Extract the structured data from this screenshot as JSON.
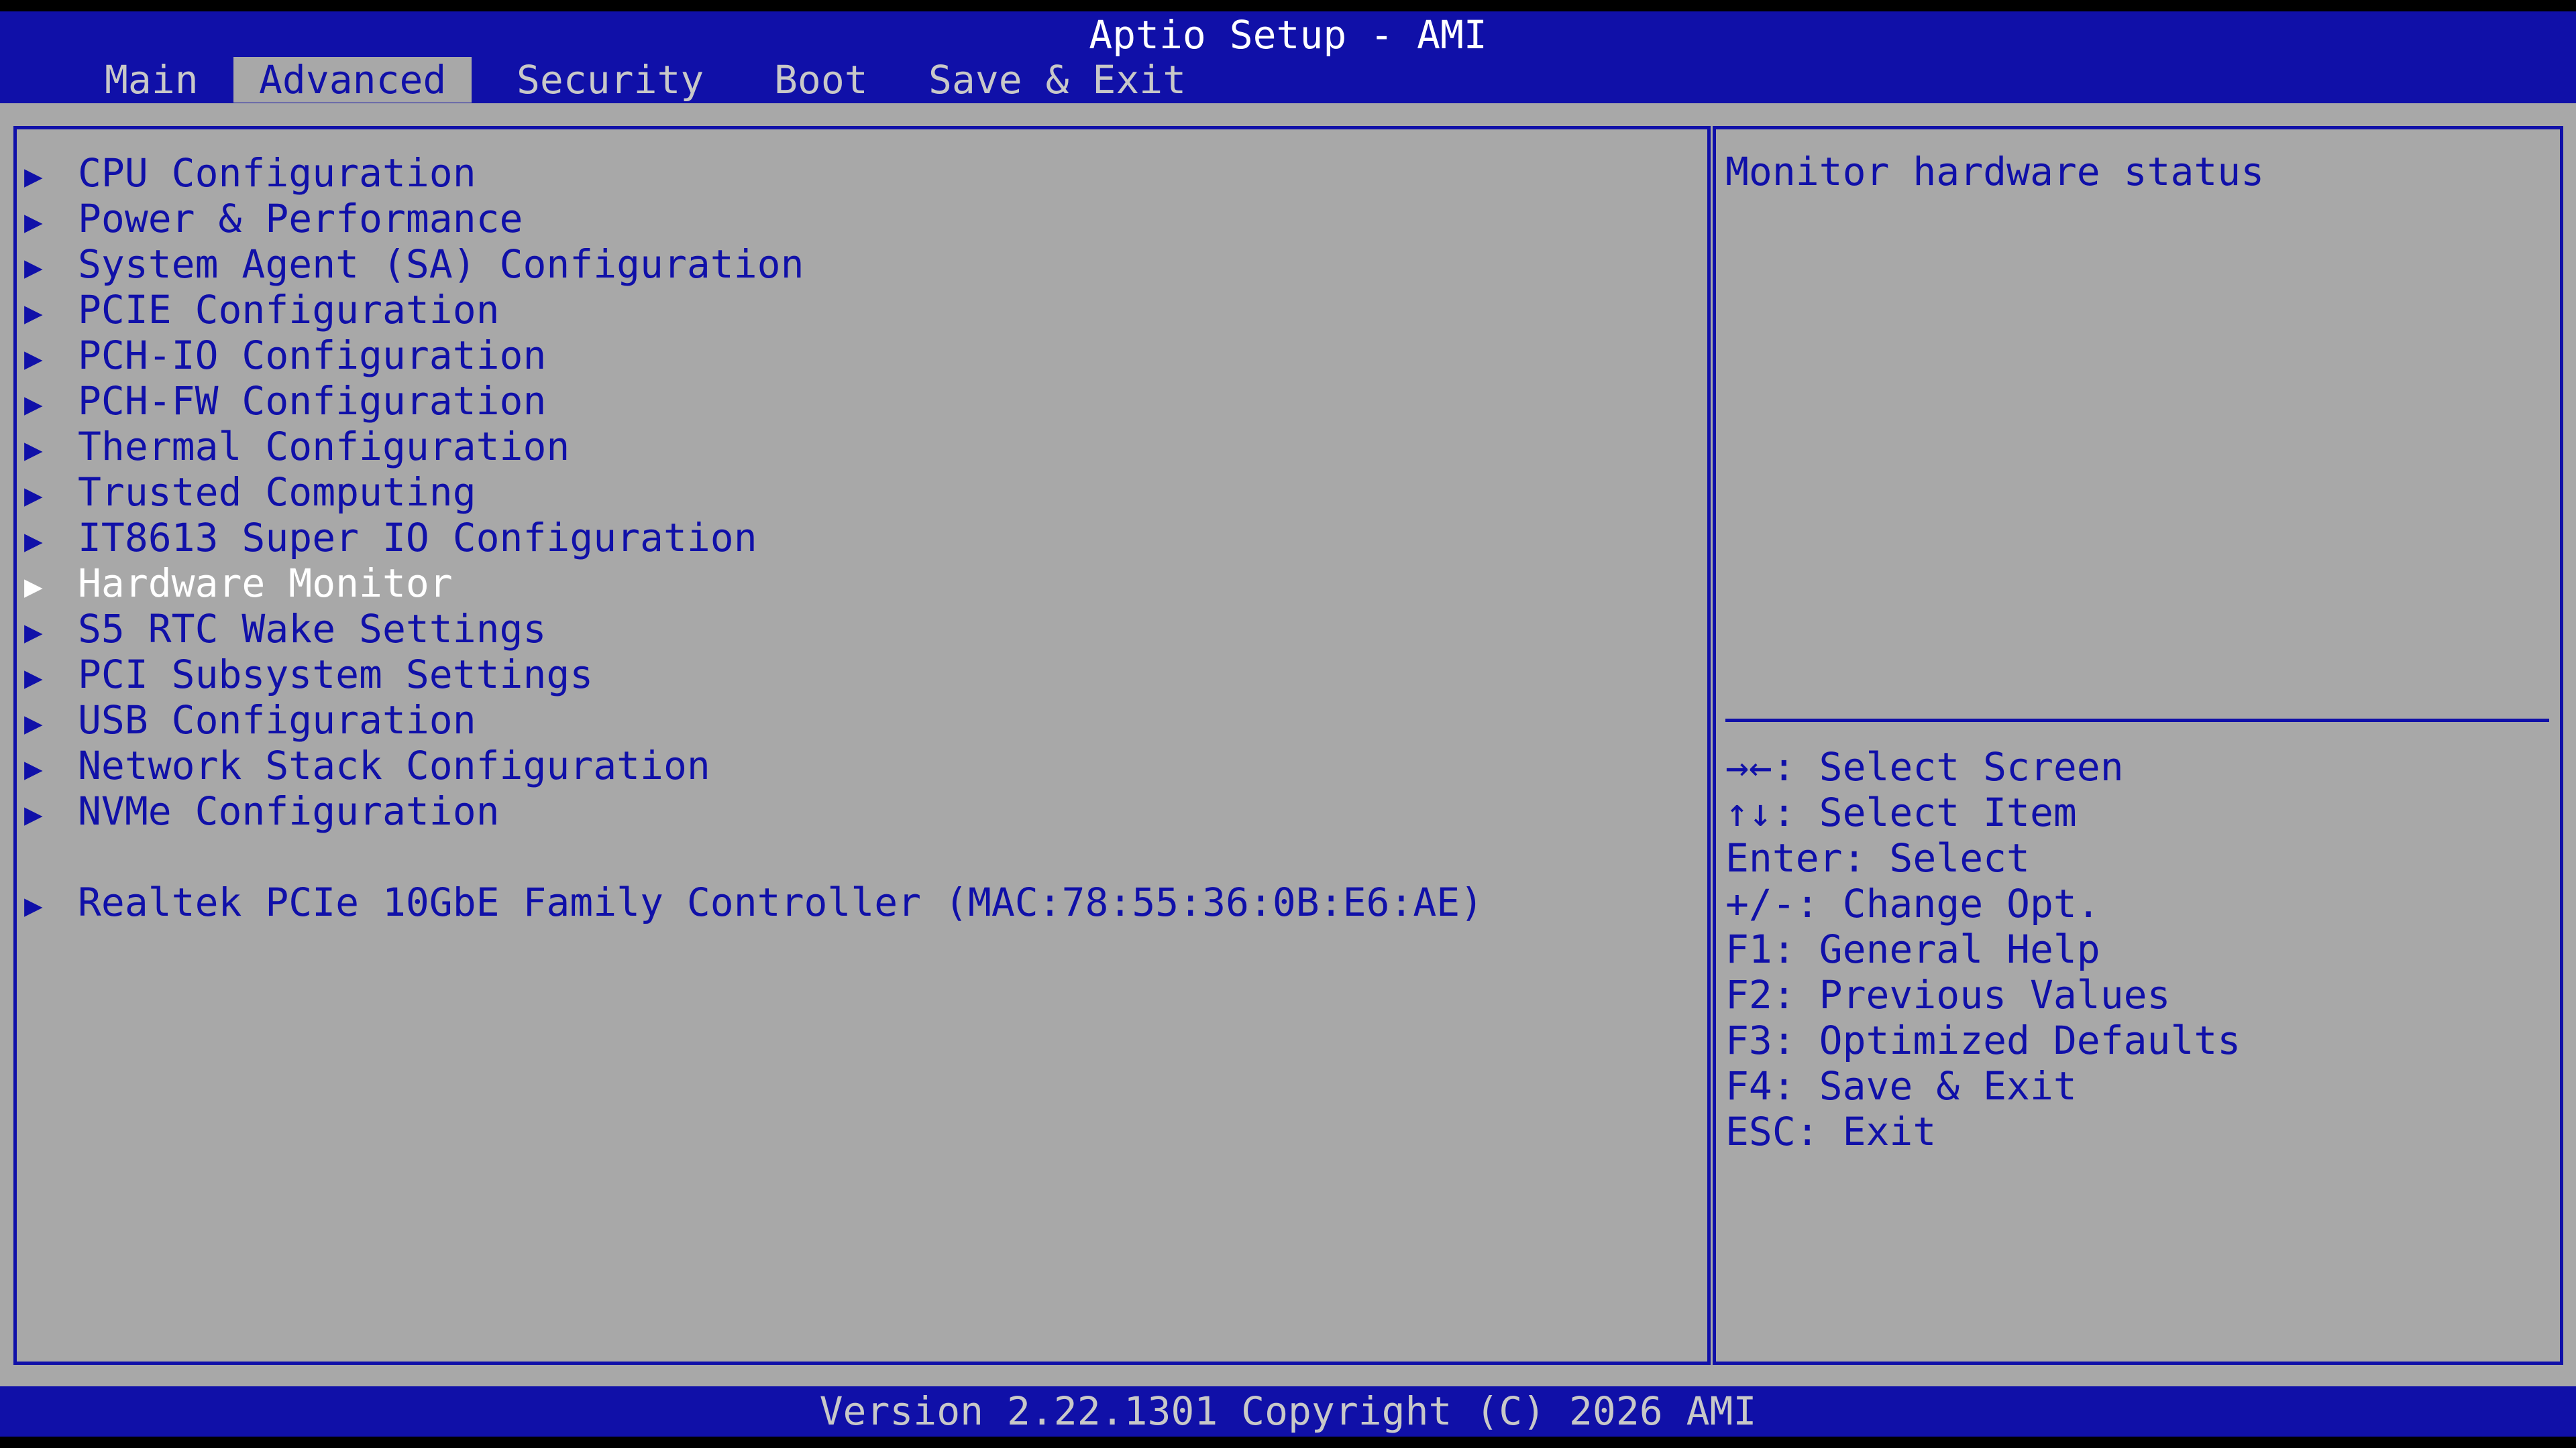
{
  "header": {
    "title": "Aptio Setup - AMI",
    "tabs": [
      {
        "label": "Main",
        "active": false
      },
      {
        "label": "Advanced",
        "active": true
      },
      {
        "label": "Security",
        "active": false
      },
      {
        "label": "Boot",
        "active": false
      },
      {
        "label": "Save & Exit",
        "active": false
      }
    ]
  },
  "menu": {
    "arrow_glyph": "▶",
    "selected_index": 9,
    "items": [
      {
        "label": "CPU Configuration"
      },
      {
        "label": "Power & Performance"
      },
      {
        "label": "System Agent (SA) Configuration"
      },
      {
        "label": "PCIE Configuration"
      },
      {
        "label": "PCH-IO Configuration"
      },
      {
        "label": "PCH-FW Configuration"
      },
      {
        "label": "Thermal Configuration"
      },
      {
        "label": "Trusted Computing"
      },
      {
        "label": "IT8613 Super IO Configuration"
      },
      {
        "label": "Hardware Monitor"
      },
      {
        "label": "S5 RTC Wake Settings"
      },
      {
        "label": "PCI Subsystem Settings"
      },
      {
        "label": "USB Configuration"
      },
      {
        "label": "Network Stack Configuration"
      },
      {
        "label": "NVMe Configuration"
      },
      {
        "label": "Realtek PCIe 10GbE Family Controller (MAC:78:55:36:0B:E6:AE)"
      }
    ]
  },
  "help": {
    "text": "Monitor hardware status",
    "keys": [
      "→←: Select Screen",
      "↑↓: Select Item",
      "Enter: Select",
      "+/-: Change Opt.",
      "F1: General Help",
      "F2: Previous Values",
      "F3: Optimized Defaults",
      "F4: Save & Exit",
      "ESC: Exit"
    ]
  },
  "footer": {
    "version": "Version 2.22.1301 Copyright (C) 2026 AMI"
  },
  "colors": {
    "bar_blue": "#1010a8",
    "panel_gray": "#a8a8a8",
    "text_blue": "#1010a8",
    "selected_text": "#ffffff",
    "inactive_tab_text": "#c8c8c8"
  }
}
